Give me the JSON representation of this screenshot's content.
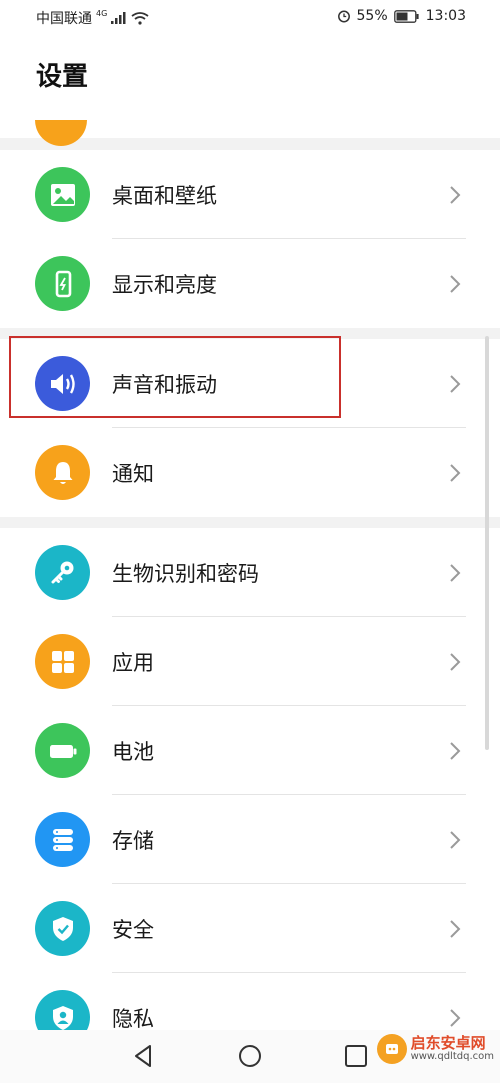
{
  "status": {
    "carrier": "中国联通",
    "network": "4G",
    "battery": "55%",
    "time": "13:03"
  },
  "header": {
    "title": "设置"
  },
  "sections": [
    {
      "items": [
        {
          "label": "桌面和壁纸",
          "icon": "wallpaper-icon",
          "color": "#3dc55b"
        },
        {
          "label": "显示和亮度",
          "icon": "display-icon",
          "color": "#3dc55b"
        }
      ]
    },
    {
      "items": [
        {
          "label": "声音和振动",
          "icon": "sound-icon",
          "color": "#3b5bdb"
        },
        {
          "label": "通知",
          "icon": "bell-icon",
          "color": "#f7a21b"
        }
      ]
    },
    {
      "items": [
        {
          "label": "生物识别和密码",
          "icon": "key-icon",
          "color": "#1bb6c8"
        },
        {
          "label": "应用",
          "icon": "apps-icon",
          "color": "#f7a21b"
        },
        {
          "label": "电池",
          "icon": "battery-icon",
          "color": "#3dc55b"
        },
        {
          "label": "存储",
          "icon": "storage-icon",
          "color": "#2196f3"
        },
        {
          "label": "安全",
          "icon": "shield-icon",
          "color": "#1bb6c8"
        },
        {
          "label": "隐私",
          "icon": "privacy-icon",
          "color": "#1bb6c8"
        }
      ]
    }
  ],
  "watermark": {
    "title": "启东安卓网",
    "url": "www.qdltdq.com"
  }
}
